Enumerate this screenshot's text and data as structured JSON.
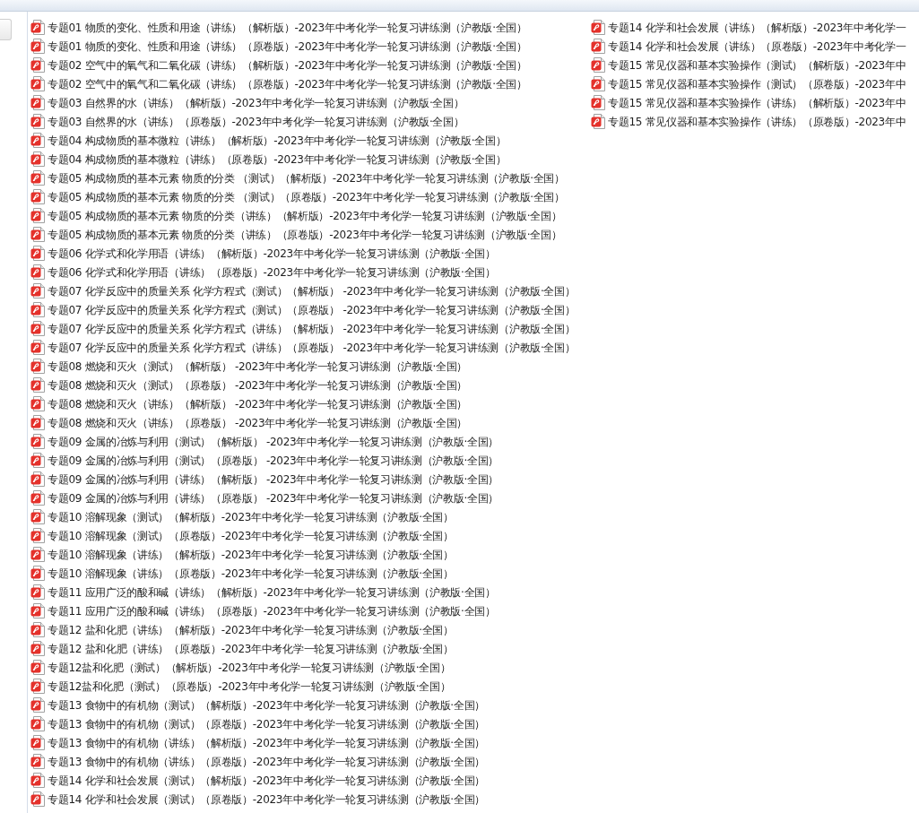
{
  "files": [
    {
      "name": "专题01 物质的变化、性质和用途（讲练）（解析版）-2023年中考化学一轮复习讲练测（沪教版·全国）"
    },
    {
      "name": "专题01 物质的变化、性质和用途（讲练）（原卷版）-2023年中考化学一轮复习讲练测（沪教版·全国）"
    },
    {
      "name": "专题02 空气中的氧气和二氧化碳（讲练）（解析版）-2023年中考化学一轮复习讲练测（沪教版·全国）"
    },
    {
      "name": "专题02 空气中的氧气和二氧化碳（讲练）（原卷版）-2023年中考化学一轮复习讲练测（沪教版·全国）"
    },
    {
      "name": "专题03 自然界的水（讲练）（解析版）-2023年中考化学一轮复习讲练测（沪教版·全国）"
    },
    {
      "name": "专题03 自然界的水（讲练）（原卷版）-2023年中考化学一轮复习讲练测（沪教版·全国）"
    },
    {
      "name": "专题04 构成物质的基本微粒（讲练）（解析版）-2023年中考化学一轮复习讲练测（沪教版·全国）"
    },
    {
      "name": "专题04 构成物质的基本微粒（讲练）（原卷版）-2023年中考化学一轮复习讲练测（沪教版·全国）"
    },
    {
      "name": "专题05 构成物质的基本元素 物质的分类 （测试）（解析版）-2023年中考化学一轮复习讲练测（沪教版·全国）"
    },
    {
      "name": "专题05 构成物质的基本元素 物质的分类 （测试）（原卷版）-2023年中考化学一轮复习讲练测（沪教版·全国）"
    },
    {
      "name": "专题05 构成物质的基本元素 物质的分类（讲练）（解析版）-2023年中考化学一轮复习讲练测（沪教版·全国）"
    },
    {
      "name": "专题05 构成物质的基本元素 物质的分类（讲练）（原卷版）-2023年中考化学一轮复习讲练测（沪教版·全国）"
    },
    {
      "name": "专题06 化学式和化学用语（讲练）（解析版）-2023年中考化学一轮复习讲练测（沪教版·全国）"
    },
    {
      "name": "专题06 化学式和化学用语（讲练）（原卷版）-2023年中考化学一轮复习讲练测（沪教版·全国）"
    },
    {
      "name": "专题07 化学反应中的质量关系 化学方程式（测试）（解析版） -2023年中考化学一轮复习讲练测（沪教版·全国）"
    },
    {
      "name": "专题07 化学反应中的质量关系 化学方程式（测试）（原卷版） -2023年中考化学一轮复习讲练测（沪教版·全国）"
    },
    {
      "name": "专题07 化学反应中的质量关系 化学方程式（讲练）（解析版） -2023年中考化学一轮复习讲练测（沪教版·全国）"
    },
    {
      "name": "专题07 化学反应中的质量关系 化学方程式（讲练）（原卷版） -2023年中考化学一轮复习讲练测（沪教版·全国）"
    },
    {
      "name": "专题08 燃烧和灭火（测试）（解析版） -2023年中考化学一轮复习讲练测（沪教版·全国）"
    },
    {
      "name": "专题08 燃烧和灭火（测试）（原卷版） -2023年中考化学一轮复习讲练测（沪教版·全国）"
    },
    {
      "name": "专题08 燃烧和灭火（讲练）（解析版） -2023年中考化学一轮复习讲练测（沪教版·全国）"
    },
    {
      "name": "专题08 燃烧和灭火（讲练）（原卷版） -2023年中考化学一轮复习讲练测（沪教版·全国）"
    },
    {
      "name": "专题09 金属的冶炼与利用（测试）（解析版） -2023年中考化学一轮复习讲练测（沪教版·全国）"
    },
    {
      "name": "专题09 金属的冶炼与利用（测试）（原卷版） -2023年中考化学一轮复习讲练测（沪教版·全国）"
    },
    {
      "name": "专题09 金属的冶炼与利用（讲练）（解析版） -2023年中考化学一轮复习讲练测（沪教版·全国）"
    },
    {
      "name": "专题09 金属的冶炼与利用（讲练）（原卷版） -2023年中考化学一轮复习讲练测（沪教版·全国）"
    },
    {
      "name": "专题10 溶解现象（测试）（解析版）-2023年中考化学一轮复习讲练测（沪教版·全国）"
    },
    {
      "name": "专题10 溶解现象（测试）（原卷版）-2023年中考化学一轮复习讲练测（沪教版·全国）"
    },
    {
      "name": "专题10 溶解现象（讲练）（解析版）-2023年中考化学一轮复习讲练测（沪教版·全国）"
    },
    {
      "name": "专题10 溶解现象（讲练）（原卷版）-2023年中考化学一轮复习讲练测（沪教版·全国）"
    },
    {
      "name": "专题11 应用广泛的酸和碱（讲练）（解析版）-2023年中考化学一轮复习讲练测（沪教版·全国）"
    },
    {
      "name": "专题11 应用广泛的酸和碱（讲练）（原卷版）-2023年中考化学一轮复习讲练测（沪教版·全国）"
    },
    {
      "name": "专题12 盐和化肥（讲练）（解析版）-2023年中考化学一轮复习讲练测（沪教版·全国）"
    },
    {
      "name": "专题12 盐和化肥（讲练）（原卷版）-2023年中考化学一轮复习讲练测（沪教版·全国）"
    },
    {
      "name": "专题12盐和化肥（测试）（解析版）-2023年中考化学一轮复习讲练测（沪教版·全国）"
    },
    {
      "name": "专题12盐和化肥（测试）（原卷版）-2023年中考化学一轮复习讲练测（沪教版·全国）"
    },
    {
      "name": "专题13 食物中的有机物（测试）（解析版）-2023年中考化学一轮复习讲练测（沪教版·全国）"
    },
    {
      "name": "专题13 食物中的有机物（测试）（原卷版）-2023年中考化学一轮复习讲练测（沪教版·全国）"
    },
    {
      "name": "专题13 食物中的有机物（讲练）（解析版）-2023年中考化学一轮复习讲练测（沪教版·全国）"
    },
    {
      "name": "专题13 食物中的有机物（讲练）（原卷版）-2023年中考化学一轮复习讲练测（沪教版·全国）"
    },
    {
      "name": "专题14 化学和社会发展（测试）（解析版）-2023年中考化学一轮复习讲练测（沪教版·全国）"
    },
    {
      "name": "专题14 化学和社会发展（测试）（原卷版）-2023年中考化学一轮复习讲练测（沪教版·全国）"
    },
    {
      "name": "专题14 化学和社会发展（讲练）（解析版）-2023年中考化学一"
    },
    {
      "name": "专题14 化学和社会发展（讲练）（原卷版）-2023年中考化学一"
    },
    {
      "name": "专题15 常见仪器和基本实验操作（测试）（解析版）-2023年中"
    },
    {
      "name": "专题15 常见仪器和基本实验操作（测试）（原卷版）-2023年中"
    },
    {
      "name": "专题15 常见仪器和基本实验操作（讲练）（解析版）-2023年中"
    },
    {
      "name": "专题15 常见仪器和基本实验操作（讲练）（原卷版）-2023年中"
    }
  ]
}
